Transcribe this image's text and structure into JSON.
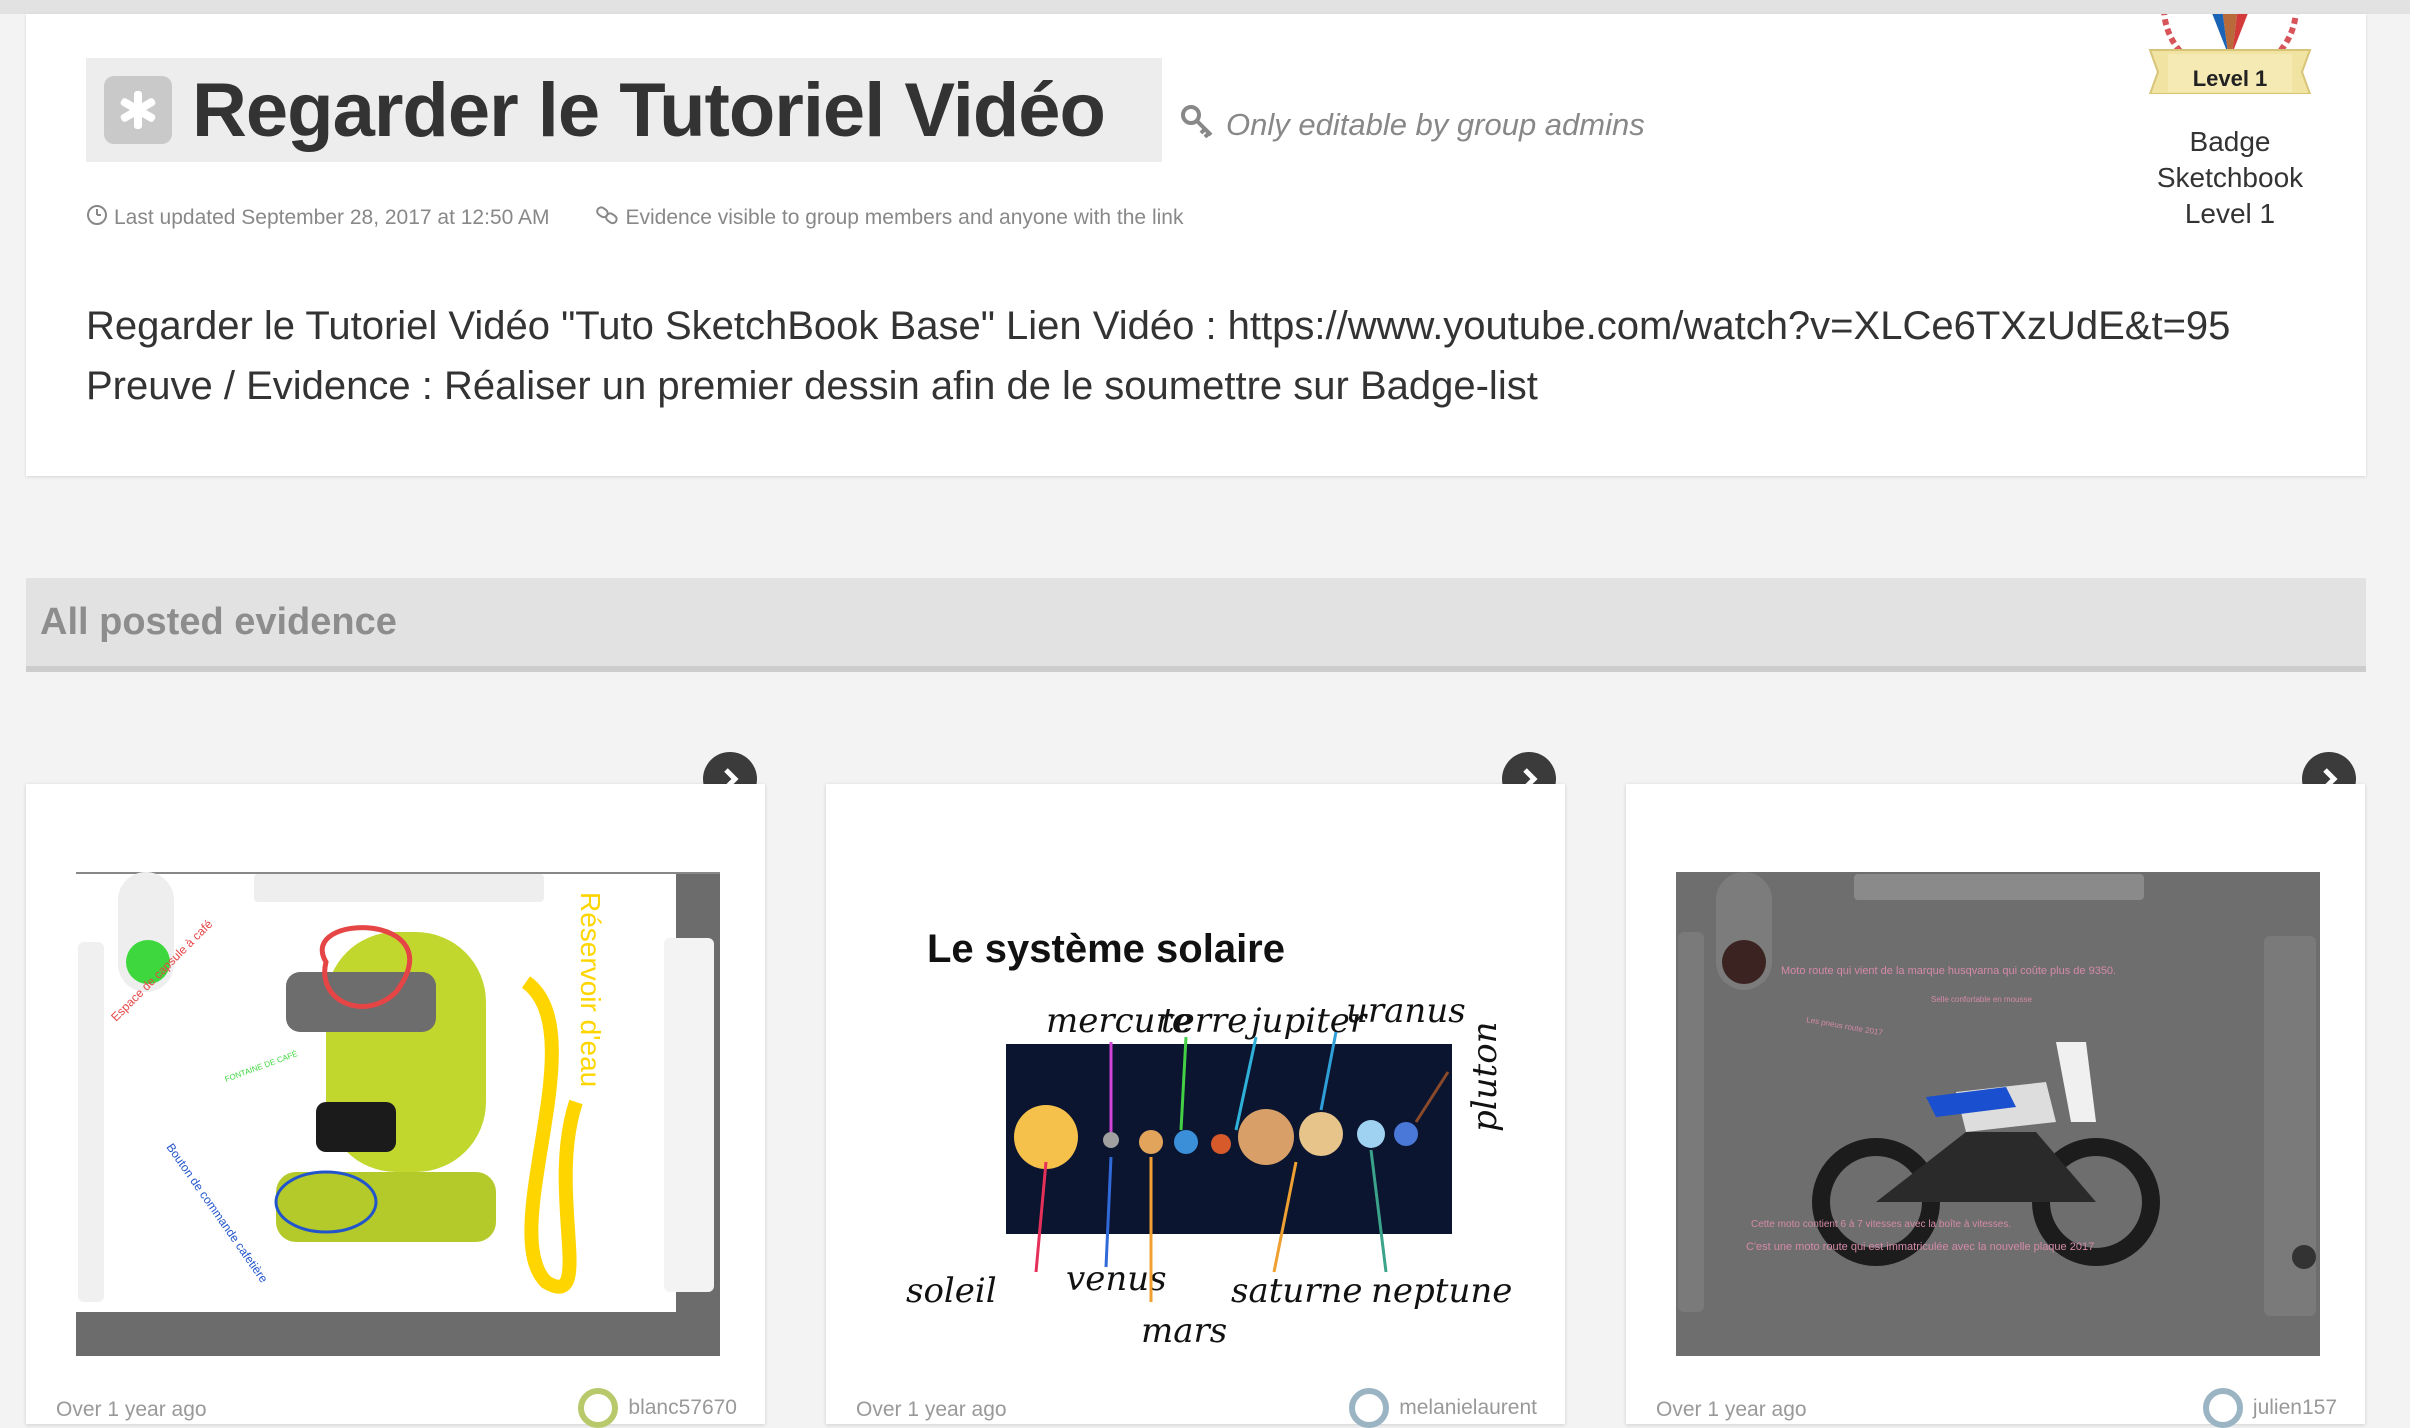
{
  "header": {
    "title": "Regarder le Tutoriel Vidéo",
    "editable_note": "Only editable by group admins",
    "last_updated": "Last updated September 28, 2017 at 12:50 AM",
    "visibility": "Evidence visible to group members and anyone with the link",
    "description_line1": "Regarder le Tutoriel Vidéo \"Tuto SketchBook Base\" Lien Vidéo : https://www.youtube.com/watch?v=XLCe6TXzUdE&t=95",
    "description_line2": "Preuve / Evidence : Réaliser un premier dessin afin de le soumettre sur Badge-list"
  },
  "badge": {
    "ribbon_text": "Level 1",
    "caption_line1": "Badge",
    "caption_line2": "Sketchbook",
    "caption_line3": "Level 1"
  },
  "evidence": {
    "section_title": "All posted evidence",
    "cards": [
      {
        "time": "Over 1 year ago",
        "user": "blanc57670",
        "annotations": [
          "Espace de capsule à café",
          "FONTAINE DE CAFÉ",
          "Bouton de commande cafetière",
          "Réservoir d'eau"
        ]
      },
      {
        "time": "Over 1 year ago",
        "user": "melanielaurent",
        "title": "Le système solaire",
        "labels": [
          "mercure",
          "terre",
          "jupiter",
          "uranus",
          "pluton",
          "soleil",
          "venus",
          "mars",
          "saturne",
          "neptune"
        ]
      },
      {
        "time": "Over 1 year ago",
        "user": "julien157",
        "annotations": [
          "Moto route qui vient de la marque husqvarna qui coûte plus de 9350.",
          "Selle confortable en mousse",
          "Les pneus route 2017",
          "Cette moto contient 6 à 7 vitesses avec la boîte à vitesses.",
          "C'est une moto route qui est immatriculée avec la nouvelle plaque 2017"
        ]
      }
    ]
  },
  "colors": {
    "accent_dark": "#3b3b3b",
    "header_gray": "#e2e2e2",
    "text_muted": "#888888"
  }
}
